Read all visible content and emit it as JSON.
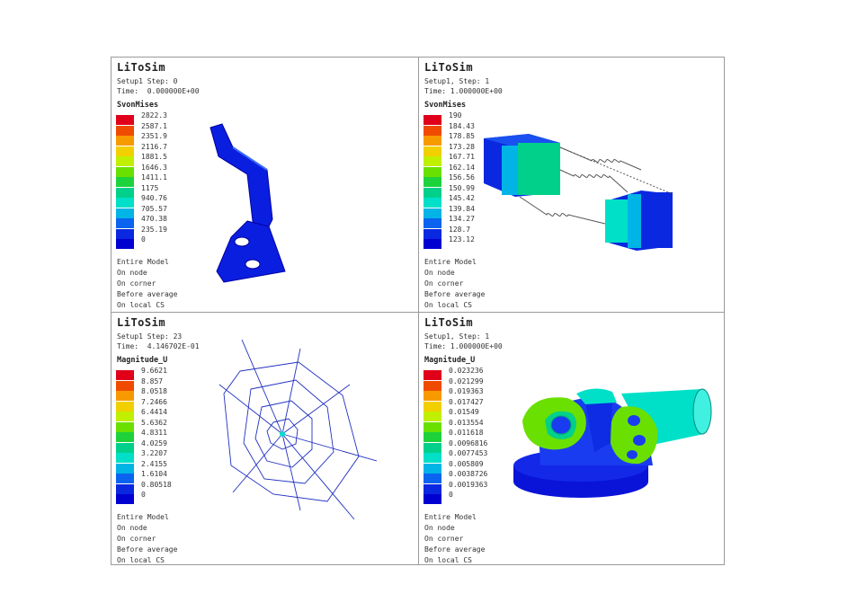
{
  "colors": [
    "#e0001a",
    "#f04a00",
    "#f79a00",
    "#f2d000",
    "#c0f000",
    "#6ae000",
    "#1ed23c",
    "#00d08a",
    "#00e0c8",
    "#00b4e6",
    "#0a64f0",
    "#0a28e0",
    "#0000d0"
  ],
  "panels": [
    {
      "title": "LiToSim",
      "setup": "Setup1 Step: 0",
      "time": "Time:  0.000000E+00",
      "variable": "SvonMises",
      "legend": [
        "2822.3",
        "2587.1",
        "2351.9",
        "2116.7",
        "1881.5",
        "1646.3",
        "1411.1",
        "1175",
        "940.76",
        "705.57",
        "470.38",
        "235.19",
        "0"
      ],
      "footer": [
        "Entire Model",
        "On node",
        "On corner",
        "Before average",
        "On local CS"
      ]
    },
    {
      "title": "LiToSim",
      "setup": "Setup1, Step: 1",
      "time": "Time: 1.000000E+00",
      "variable": "SvonMises",
      "legend": [
        "190",
        "184.43",
        "178.85",
        "173.28",
        "167.71",
        "162.14",
        "156.56",
        "150.99",
        "145.42",
        "139.84",
        "134.27",
        "128.7",
        "123.12"
      ],
      "footer": [
        "Entire Model",
        "On node",
        "On corner",
        "Before average",
        "On local CS"
      ]
    },
    {
      "title": "LiToSim",
      "setup": "Setup1 Step: 23",
      "time": "Time:  4.146702E-01",
      "variable": "Magnitude_U",
      "legend": [
        "9.6621",
        "8.857",
        "8.0518",
        "7.2466",
        "6.4414",
        "5.6362",
        "4.8311",
        "4.0259",
        "3.2207",
        "2.4155",
        "1.6104",
        "0.80518",
        "0"
      ],
      "footer": [
        "Entire Model",
        "On node",
        "On corner",
        "Before average",
        "On local CS"
      ]
    },
    {
      "title": "LiToSim",
      "setup": "Setup1, Step: 1",
      "time": "Time: 1.000000E+00",
      "variable": "Magnitude_U",
      "legend": [
        "0.023236",
        "0.021299",
        "0.019363",
        "0.017427",
        "0.01549",
        "0.013554",
        "0.011618",
        "0.0096816",
        "0.0077453",
        "0.005809",
        "0.0038726",
        "0.0019363",
        "0"
      ],
      "footer": [
        "Entire Model",
        "On node",
        "On corner",
        "Before average",
        "On local CS"
      ]
    }
  ],
  "models": [
    "bent-bracket-model",
    "spring-blocks-model",
    "spider-web-mesh-model",
    "housing-part-model"
  ]
}
